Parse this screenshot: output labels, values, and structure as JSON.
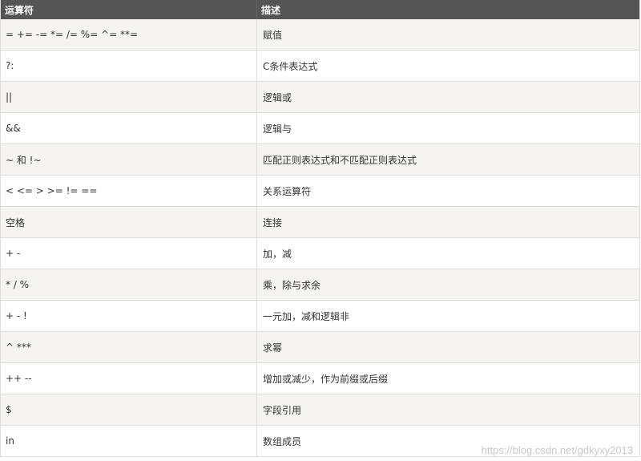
{
  "table": {
    "headers": [
      "运算符",
      "描述"
    ],
    "rows": [
      {
        "op": "= += -= *= /= %= ^= **=",
        "desc": "赋值"
      },
      {
        "op": "?:",
        "desc": "C条件表达式"
      },
      {
        "op": "||",
        "desc": "逻辑或"
      },
      {
        "op": "&&",
        "desc": "逻辑与"
      },
      {
        "op": "~ 和 !~",
        "desc": "匹配正则表达式和不匹配正则表达式"
      },
      {
        "op": "< <= > >= != ==",
        "desc": "关系运算符"
      },
      {
        "op": "空格",
        "desc": "连接"
      },
      {
        "op": "+ -",
        "desc": "加，减"
      },
      {
        "op": "* / %",
        "desc": "乘，除与求余"
      },
      {
        "op": "+ - !",
        "desc": "一元加，减和逻辑非"
      },
      {
        "op": "^ ***",
        "desc": "求幂"
      },
      {
        "op": "++ --",
        "desc": "增加或减少，作为前缀或后缀"
      },
      {
        "op": "$",
        "desc": "字段引用"
      },
      {
        "op": "in",
        "desc": "数组成员"
      }
    ]
  },
  "watermark": "https://blog.csdn.net/gdkyxy2013"
}
